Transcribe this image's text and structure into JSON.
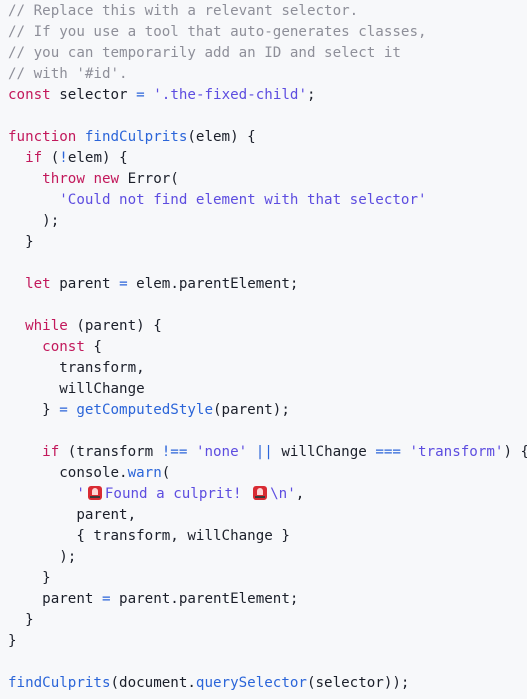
{
  "code": {
    "language": "javascript",
    "colors": {
      "background": "#f7f8fa",
      "plain": "#1b1f2a",
      "comment": "#8e8f99",
      "keyword": "#c2185b",
      "string": "#5d4de0",
      "function": "#2b65d9",
      "operator": "#2b65d9"
    },
    "lines": [
      [
        {
          "t": "comment",
          "v": "// Replace this with a relevant selector."
        }
      ],
      [
        {
          "t": "comment",
          "v": "// If you use a tool that auto-generates classes,"
        }
      ],
      [
        {
          "t": "comment",
          "v": "// you can temporarily add an ID and select it"
        }
      ],
      [
        {
          "t": "comment",
          "v": "// with '#id'."
        }
      ],
      [
        {
          "t": "keyword",
          "v": "const"
        },
        {
          "t": "plain",
          "v": " selector "
        },
        {
          "t": "operator",
          "v": "="
        },
        {
          "t": "plain",
          "v": " "
        },
        {
          "t": "string",
          "v": "'.the-fixed-child'"
        },
        {
          "t": "punct",
          "v": ";"
        }
      ],
      [],
      [
        {
          "t": "keyword",
          "v": "function"
        },
        {
          "t": "plain",
          "v": " "
        },
        {
          "t": "func",
          "v": "findCulprits"
        },
        {
          "t": "punct",
          "v": "(elem) {"
        }
      ],
      [
        {
          "t": "plain",
          "v": "  "
        },
        {
          "t": "keyword",
          "v": "if"
        },
        {
          "t": "punct",
          "v": " ("
        },
        {
          "t": "operator",
          "v": "!"
        },
        {
          "t": "plain",
          "v": "elem) {"
        }
      ],
      [
        {
          "t": "plain",
          "v": "    "
        },
        {
          "t": "keyword",
          "v": "throw"
        },
        {
          "t": "plain",
          "v": " "
        },
        {
          "t": "keyword",
          "v": "new"
        },
        {
          "t": "plain",
          "v": " Error("
        }
      ],
      [
        {
          "t": "plain",
          "v": "      "
        },
        {
          "t": "string",
          "v": "'Could not find element with that selector'"
        }
      ],
      [
        {
          "t": "plain",
          "v": "    );"
        }
      ],
      [
        {
          "t": "plain",
          "v": "  }"
        }
      ],
      [],
      [
        {
          "t": "plain",
          "v": "  "
        },
        {
          "t": "keyword",
          "v": "let"
        },
        {
          "t": "plain",
          "v": " parent "
        },
        {
          "t": "operator",
          "v": "="
        },
        {
          "t": "plain",
          "v": " elem.parentElement;"
        }
      ],
      [],
      [
        {
          "t": "plain",
          "v": "  "
        },
        {
          "t": "keyword",
          "v": "while"
        },
        {
          "t": "plain",
          "v": " (parent) {"
        }
      ],
      [
        {
          "t": "plain",
          "v": "    "
        },
        {
          "t": "keyword",
          "v": "const"
        },
        {
          "t": "plain",
          "v": " {"
        }
      ],
      [
        {
          "t": "plain",
          "v": "      transform,"
        }
      ],
      [
        {
          "t": "plain",
          "v": "      willChange"
        }
      ],
      [
        {
          "t": "plain",
          "v": "    } "
        },
        {
          "t": "operator",
          "v": "="
        },
        {
          "t": "plain",
          "v": " "
        },
        {
          "t": "func",
          "v": "getComputedStyle"
        },
        {
          "t": "plain",
          "v": "(parent);"
        }
      ],
      [],
      [
        {
          "t": "plain",
          "v": "    "
        },
        {
          "t": "keyword",
          "v": "if"
        },
        {
          "t": "plain",
          "v": " (transform "
        },
        {
          "t": "operator",
          "v": "!=="
        },
        {
          "t": "plain",
          "v": " "
        },
        {
          "t": "string",
          "v": "'none'"
        },
        {
          "t": "plain",
          "v": " "
        },
        {
          "t": "operator",
          "v": "||"
        },
        {
          "t": "plain",
          "v": " willChange "
        },
        {
          "t": "operator",
          "v": "==="
        },
        {
          "t": "plain",
          "v": " "
        },
        {
          "t": "string",
          "v": "'transform'"
        },
        {
          "t": "plain",
          "v": ") {"
        }
      ],
      [
        {
          "t": "plain",
          "v": "      console."
        },
        {
          "t": "func",
          "v": "warn"
        },
        {
          "t": "plain",
          "v": "("
        }
      ],
      [
        {
          "t": "plain",
          "v": "        "
        },
        {
          "t": "string",
          "v": "'"
        },
        {
          "t": "emoji",
          "v": "🚨"
        },
        {
          "t": "string",
          "v": "Found a culprit! "
        },
        {
          "t": "emoji",
          "v": "🚨"
        },
        {
          "t": "string",
          "v": "\\n'"
        },
        {
          "t": "plain",
          "v": ","
        }
      ],
      [
        {
          "t": "plain",
          "v": "        parent,"
        }
      ],
      [
        {
          "t": "plain",
          "v": "        { transform, willChange }"
        }
      ],
      [
        {
          "t": "plain",
          "v": "      );"
        }
      ],
      [
        {
          "t": "plain",
          "v": "    }"
        }
      ],
      [
        {
          "t": "plain",
          "v": "    parent "
        },
        {
          "t": "operator",
          "v": "="
        },
        {
          "t": "plain",
          "v": " parent.parentElement;"
        }
      ],
      [
        {
          "t": "plain",
          "v": "  }"
        }
      ],
      [
        {
          "t": "plain",
          "v": "}"
        }
      ],
      [],
      [
        {
          "t": "func",
          "v": "findCulprits"
        },
        {
          "t": "plain",
          "v": "(document."
        },
        {
          "t": "func",
          "v": "querySelector"
        },
        {
          "t": "plain",
          "v": "(selector));"
        }
      ]
    ]
  }
}
